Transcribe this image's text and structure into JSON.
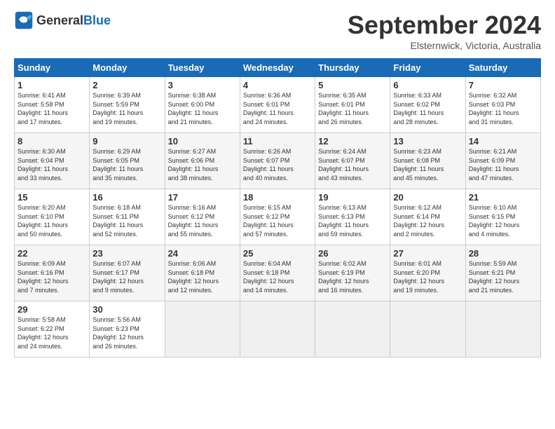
{
  "header": {
    "logo_general": "General",
    "logo_blue": "Blue",
    "month_title": "September 2024",
    "location": "Elsternwick, Victoria, Australia"
  },
  "calendar": {
    "headers": [
      "Sunday",
      "Monday",
      "Tuesday",
      "Wednesday",
      "Thursday",
      "Friday",
      "Saturday"
    ],
    "weeks": [
      [
        {
          "day": "",
          "info": ""
        },
        {
          "day": "2",
          "info": "Sunrise: 6:39 AM\nSunset: 5:59 PM\nDaylight: 11 hours\nand 19 minutes."
        },
        {
          "day": "3",
          "info": "Sunrise: 6:38 AM\nSunset: 6:00 PM\nDaylight: 11 hours\nand 21 minutes."
        },
        {
          "day": "4",
          "info": "Sunrise: 6:36 AM\nSunset: 6:01 PM\nDaylight: 11 hours\nand 24 minutes."
        },
        {
          "day": "5",
          "info": "Sunrise: 6:35 AM\nSunset: 6:01 PM\nDaylight: 11 hours\nand 26 minutes."
        },
        {
          "day": "6",
          "info": "Sunrise: 6:33 AM\nSunset: 6:02 PM\nDaylight: 11 hours\nand 28 minutes."
        },
        {
          "day": "7",
          "info": "Sunrise: 6:32 AM\nSunset: 6:03 PM\nDaylight: 11 hours\nand 31 minutes."
        }
      ],
      [
        {
          "day": "1",
          "info": "Sunrise: 6:41 AM\nSunset: 5:58 PM\nDaylight: 11 hours\nand 17 minutes."
        },
        {
          "day": "",
          "info": ""
        },
        {
          "day": "",
          "info": ""
        },
        {
          "day": "",
          "info": ""
        },
        {
          "day": "",
          "info": ""
        },
        {
          "day": "",
          "info": ""
        },
        {
          "day": "",
          "info": ""
        }
      ],
      [
        {
          "day": "8",
          "info": "Sunrise: 6:30 AM\nSunset: 6:04 PM\nDaylight: 11 hours\nand 33 minutes."
        },
        {
          "day": "9",
          "info": "Sunrise: 6:29 AM\nSunset: 6:05 PM\nDaylight: 11 hours\nand 35 minutes."
        },
        {
          "day": "10",
          "info": "Sunrise: 6:27 AM\nSunset: 6:06 PM\nDaylight: 11 hours\nand 38 minutes."
        },
        {
          "day": "11",
          "info": "Sunrise: 6:26 AM\nSunset: 6:07 PM\nDaylight: 11 hours\nand 40 minutes."
        },
        {
          "day": "12",
          "info": "Sunrise: 6:24 AM\nSunset: 6:07 PM\nDaylight: 11 hours\nand 43 minutes."
        },
        {
          "day": "13",
          "info": "Sunrise: 6:23 AM\nSunset: 6:08 PM\nDaylight: 11 hours\nand 45 minutes."
        },
        {
          "day": "14",
          "info": "Sunrise: 6:21 AM\nSunset: 6:09 PM\nDaylight: 11 hours\nand 47 minutes."
        }
      ],
      [
        {
          "day": "15",
          "info": "Sunrise: 6:20 AM\nSunset: 6:10 PM\nDaylight: 11 hours\nand 50 minutes."
        },
        {
          "day": "16",
          "info": "Sunrise: 6:18 AM\nSunset: 6:11 PM\nDaylight: 11 hours\nand 52 minutes."
        },
        {
          "day": "17",
          "info": "Sunrise: 6:16 AM\nSunset: 6:12 PM\nDaylight: 11 hours\nand 55 minutes."
        },
        {
          "day": "18",
          "info": "Sunrise: 6:15 AM\nSunset: 6:12 PM\nDaylight: 11 hours\nand 57 minutes."
        },
        {
          "day": "19",
          "info": "Sunrise: 6:13 AM\nSunset: 6:13 PM\nDaylight: 11 hours\nand 59 minutes."
        },
        {
          "day": "20",
          "info": "Sunrise: 6:12 AM\nSunset: 6:14 PM\nDaylight: 12 hours\nand 2 minutes."
        },
        {
          "day": "21",
          "info": "Sunrise: 6:10 AM\nSunset: 6:15 PM\nDaylight: 12 hours\nand 4 minutes."
        }
      ],
      [
        {
          "day": "22",
          "info": "Sunrise: 6:09 AM\nSunset: 6:16 PM\nDaylight: 12 hours\nand 7 minutes."
        },
        {
          "day": "23",
          "info": "Sunrise: 6:07 AM\nSunset: 6:17 PM\nDaylight: 12 hours\nand 9 minutes."
        },
        {
          "day": "24",
          "info": "Sunrise: 6:06 AM\nSunset: 6:18 PM\nDaylight: 12 hours\nand 12 minutes."
        },
        {
          "day": "25",
          "info": "Sunrise: 6:04 AM\nSunset: 6:18 PM\nDaylight: 12 hours\nand 14 minutes."
        },
        {
          "day": "26",
          "info": "Sunrise: 6:02 AM\nSunset: 6:19 PM\nDaylight: 12 hours\nand 16 minutes."
        },
        {
          "day": "27",
          "info": "Sunrise: 6:01 AM\nSunset: 6:20 PM\nDaylight: 12 hours\nand 19 minutes."
        },
        {
          "day": "28",
          "info": "Sunrise: 5:59 AM\nSunset: 6:21 PM\nDaylight: 12 hours\nand 21 minutes."
        }
      ],
      [
        {
          "day": "29",
          "info": "Sunrise: 5:58 AM\nSunset: 6:22 PM\nDaylight: 12 hours\nand 24 minutes."
        },
        {
          "day": "30",
          "info": "Sunrise: 5:56 AM\nSunset: 6:23 PM\nDaylight: 12 hours\nand 26 minutes."
        },
        {
          "day": "",
          "info": ""
        },
        {
          "day": "",
          "info": ""
        },
        {
          "day": "",
          "info": ""
        },
        {
          "day": "",
          "info": ""
        },
        {
          "day": "",
          "info": ""
        }
      ]
    ]
  }
}
